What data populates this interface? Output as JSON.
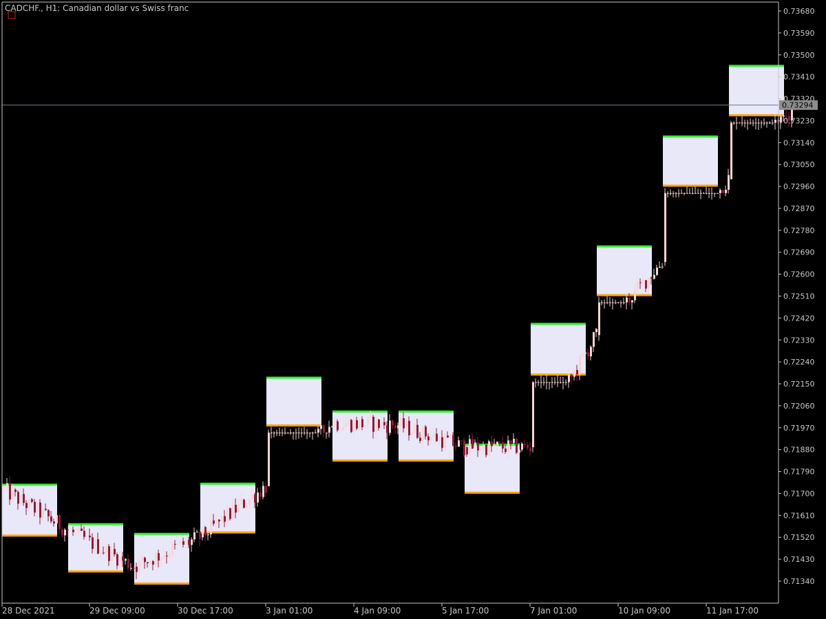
{
  "header": {
    "title": "CADCHF., H1:  Canadian dollar vs Swiss franc"
  },
  "colors": {
    "background": "#000000",
    "bull": "#f7d5d5",
    "bear": "#8c1c3c",
    "box_fill": "#e8e8f8",
    "box_high_line": "#33ee33",
    "box_low_line": "#ffa500",
    "axis": "#c8c8c8",
    "price_line": "#6b7b8c"
  },
  "chart_data": {
    "type": "candlestick",
    "symbol": "CADCHF.",
    "timeframe": "H1",
    "ylim": [
      0.713,
      0.7373
    ],
    "y_ticks": [
      "0.73680",
      "0.73590",
      "0.73500",
      "0.73410",
      "0.73320",
      "0.73230",
      "0.73140",
      "0.73050",
      "0.72960",
      "0.72870",
      "0.72780",
      "0.72690",
      "0.72600",
      "0.72510",
      "0.72420",
      "0.72330",
      "0.72240",
      "0.72150",
      "0.72060",
      "0.71970",
      "0.71880",
      "0.71790",
      "0.71700",
      "0.71610",
      "0.71520",
      "0.71430",
      "0.71340"
    ],
    "x_ticks": [
      "28 Dec 2021",
      "29 Dec 09:00",
      "30 Dec 17:00",
      "3 Jan 01:00",
      "4 Jan 09:00",
      "5 Jan 17:00",
      "7 Jan 01:00",
      "10 Jan 09:00",
      "11 Jan 17:00"
    ],
    "current_price": "0.73294",
    "sessions": [
      {
        "high": 0.71736,
        "low": 0.71527,
        "open": 0.7172,
        "close": 0.7155
      },
      {
        "high": 0.71574,
        "low": 0.7138,
        "open": 0.7155,
        "close": 0.714
      },
      {
        "high": 0.71534,
        "low": 0.7133,
        "open": 0.714,
        "close": 0.7152
      },
      {
        "high": 0.7174,
        "low": 0.7154,
        "open": 0.7152,
        "close": 0.7173
      },
      {
        "high": 0.72175,
        "low": 0.71979,
        "open": 0.7173,
        "close": 0.7199
      },
      {
        "high": 0.72036,
        "low": 0.71835,
        "open": 0.7199,
        "close": 0.7198
      },
      {
        "high": 0.72036,
        "low": 0.71835,
        "open": 0.7198,
        "close": 0.7189
      },
      {
        "high": 0.719,
        "low": 0.71703,
        "open": 0.7189,
        "close": 0.7189
      },
      {
        "high": 0.72396,
        "low": 0.72188,
        "open": 0.7189,
        "close": 0.7235
      },
      {
        "high": 0.72714,
        "low": 0.72514,
        "open": 0.7235,
        "close": 0.7265
      },
      {
        "high": 0.73165,
        "low": 0.72963,
        "open": 0.7265,
        "close": 0.7299
      },
      {
        "high": 0.73455,
        "low": 0.73252,
        "open": 0.7299,
        "close": 0.7329
      }
    ]
  }
}
